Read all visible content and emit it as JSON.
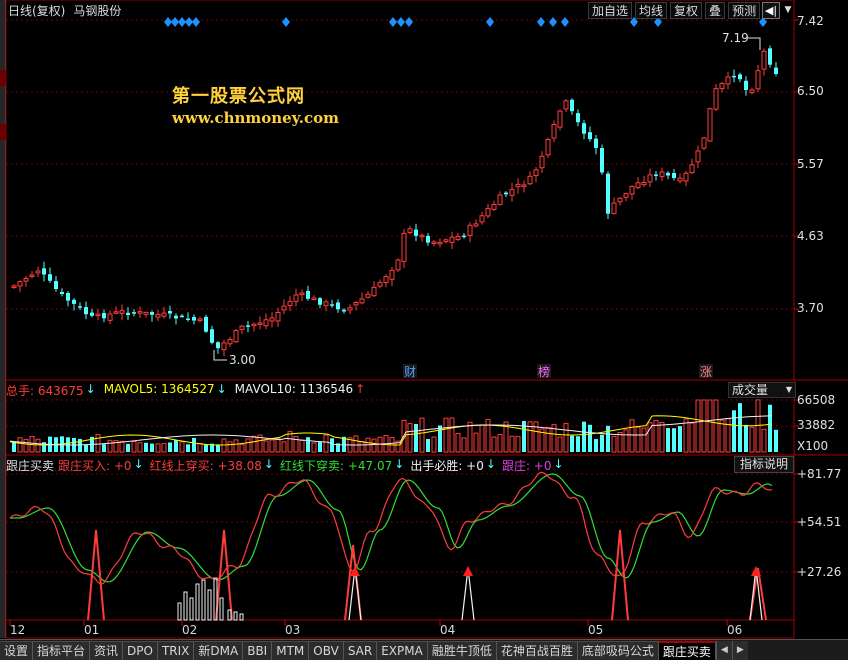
{
  "header": {
    "period": "日线(复权)",
    "stock": "马钢股份"
  },
  "toolbar": [
    {
      "label": "加自选"
    },
    {
      "label": "均线"
    },
    {
      "label": "复权"
    },
    {
      "label": "叠"
    },
    {
      "label": "预测"
    }
  ],
  "watermark": {
    "line1": "第一股票公式网",
    "line2": "www.chnmoney.com"
  },
  "price_axis": [
    "7.42",
    "6.50",
    "5.57",
    "4.63",
    "3.70"
  ],
  "annotations": {
    "high": "7.19",
    "low": "3.00",
    "events": [
      "财",
      "榜",
      "涨"
    ]
  },
  "volume_panel": {
    "total_label": "总手: 643675",
    "mavol5": "MAVOL5: 1364527",
    "mavol10": "MAVOL10: 1136546",
    "dropdown": "成交量",
    "axis": [
      "66508",
      "33882",
      "X100"
    ]
  },
  "indicator_panel": {
    "name": "跟庄买卖",
    "items": [
      {
        "label": "跟庄买入: +0",
        "color": "#ff3c3c"
      },
      {
        "label": "红线上穿买: +38.08",
        "color": "#ff3c3c"
      },
      {
        "label": "红线下穿卖: +47.07",
        "color": "#33dd33"
      },
      {
        "label": "出手必胜: +0",
        "color": "#f0f0f0"
      },
      {
        "label": "跟庄: +0",
        "color": "#e040e0"
      }
    ],
    "button": "指标说明",
    "axis": [
      "+81.77",
      "+54.51",
      "+27.26"
    ]
  },
  "date_axis": [
    "12",
    "01",
    "02",
    "03",
    "04",
    "05",
    "06"
  ],
  "tabs": [
    "设置",
    "指标平台",
    "资讯",
    "DPO",
    "TRIX",
    "新DMA",
    "BBI",
    "MTM",
    "OBV",
    "SAR",
    "EXPMA",
    "融胜牛顶低",
    "花神百战百胜",
    "底部吸码公式",
    "跟庄买卖"
  ],
  "selected_tab": "跟庄买卖",
  "colors": {
    "up": "#ff3c3c",
    "down": "#54ffff",
    "grid": "#7a0000",
    "signal": "#1e90ff"
  },
  "chart_data": {
    "type": "candlestick",
    "x": [
      "12",
      "01",
      "02",
      "03",
      "04",
      "05",
      "06"
    ],
    "price_range": [
      3.0,
      7.42
    ],
    "high": 7.19,
    "low": 3.0,
    "axis_ticks": [
      7.42,
      6.5,
      5.57,
      4.63,
      3.7
    ],
    "mavol5": 1364527,
    "mavol10": 1136546,
    "total_volume": 643675
  }
}
